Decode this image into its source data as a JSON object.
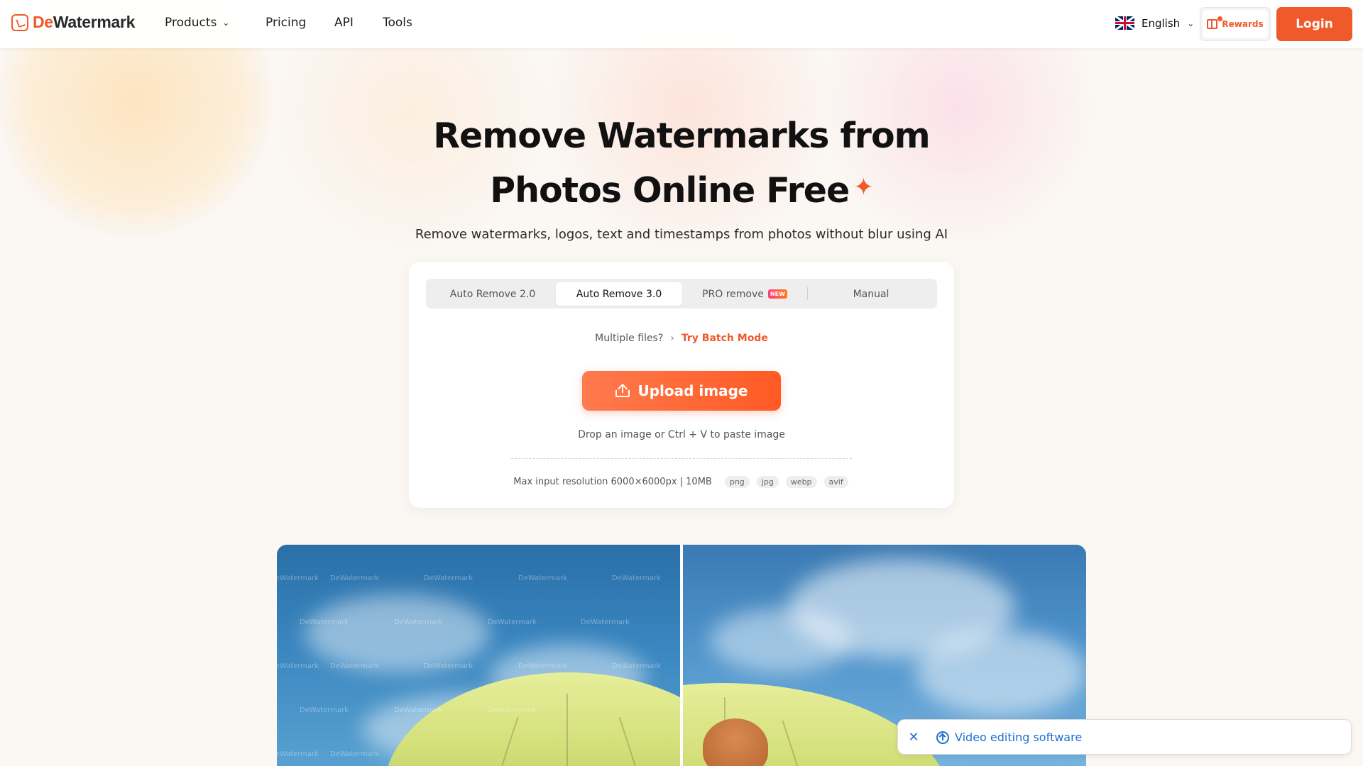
{
  "brand": {
    "name_prefix": "De",
    "name_rest": "Watermark",
    "accent": "#f0592a"
  },
  "nav": {
    "products": "Products",
    "pricing": "Pricing",
    "api": "API",
    "tools": "Tools",
    "language": "English",
    "rewards": "Rewards",
    "login": "Login"
  },
  "hero": {
    "title_line1": "Remove Watermarks from",
    "title_line2": "Photos Online Free",
    "subtitle": "Remove watermarks, logos, text and timestamps from photos without blur using AI"
  },
  "tool": {
    "tabs": [
      {
        "label": "Auto Remove 2.0",
        "active": false
      },
      {
        "label": "Auto Remove 3.0",
        "active": true
      },
      {
        "label": "PRO remove",
        "badge": "NEW",
        "active": false
      },
      {
        "label": "Manual",
        "active": false
      }
    ],
    "batch_prompt": "Multiple files?",
    "batch_link": "Try Batch Mode",
    "upload_label": "Upload image",
    "drop_hint": "Drop an image or Ctrl + V to paste image",
    "max_resolution": "Max input resolution 6000×6000px | 10MB",
    "formats": [
      "png",
      "jpg",
      "webp",
      "avif"
    ]
  },
  "compare": {
    "watermark_text": "DeWatermark"
  },
  "toast": {
    "text": "Video editing software",
    "color": "#1f6fd0"
  }
}
